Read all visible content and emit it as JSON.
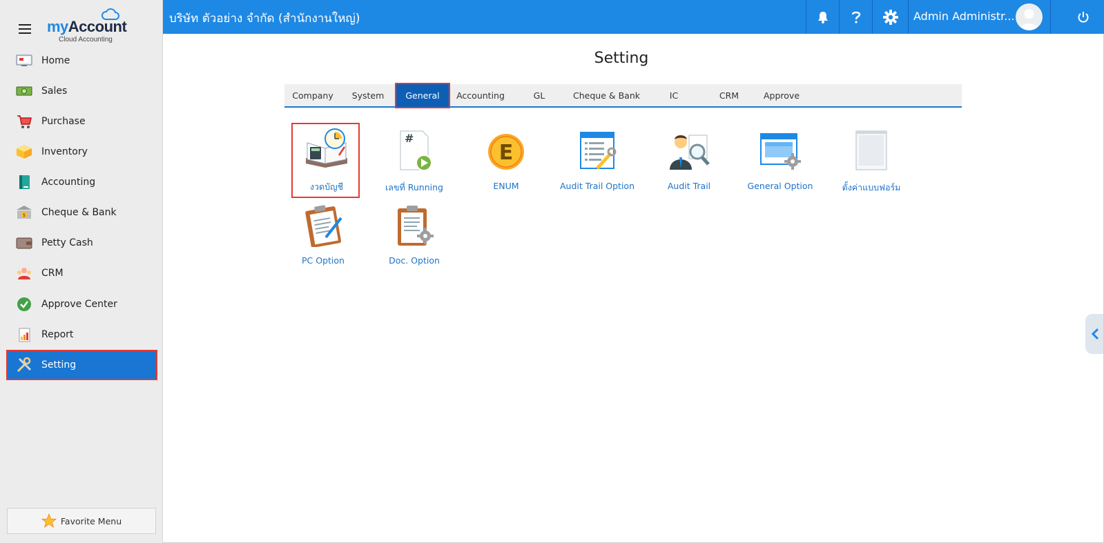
{
  "app": {
    "logo_name_prefix": "my",
    "logo_name_suffix": "Account",
    "logo_subtitle": "Cloud Accounting"
  },
  "header": {
    "company": "บริษัท ตัวอย่าง จำกัด (สำนักงานใหญ่)",
    "user": "Admin Administr...",
    "icons": [
      "bell-icon",
      "help-icon",
      "gear-icon",
      "power-icon"
    ],
    "color": "#1e88e5"
  },
  "sidebar": {
    "items": [
      {
        "label": "Home",
        "icon": "home-icon"
      },
      {
        "label": "Sales",
        "icon": "sales-icon"
      },
      {
        "label": "Purchase",
        "icon": "cart-icon"
      },
      {
        "label": "Inventory",
        "icon": "box-icon"
      },
      {
        "label": "Accounting",
        "icon": "ledger-icon"
      },
      {
        "label": "Cheque & Bank",
        "icon": "bank-icon"
      },
      {
        "label": "Petty Cash",
        "icon": "wallet-icon"
      },
      {
        "label": "CRM",
        "icon": "people-icon"
      },
      {
        "label": "Approve Center",
        "icon": "check-icon"
      },
      {
        "label": "Report",
        "icon": "report-icon"
      },
      {
        "label": "Setting",
        "icon": "tools-icon",
        "active": true
      }
    ],
    "favorite_label": "Favorite Menu",
    "active_color": "#1976d2"
  },
  "main": {
    "title": "Setting",
    "tabs": [
      {
        "label": "Company"
      },
      {
        "label": "System"
      },
      {
        "label": "General",
        "active": true
      },
      {
        "label": "Accounting"
      },
      {
        "label": "GL"
      },
      {
        "label": "Cheque & Bank"
      },
      {
        "label": "IC"
      },
      {
        "label": "CRM"
      },
      {
        "label": "Approve"
      }
    ],
    "tiles": [
      {
        "label": "งวดบัญชี",
        "icon": "accounting-period-icon",
        "selected": true
      },
      {
        "label": "เลขที่ Running",
        "icon": "running-number-icon"
      },
      {
        "label": "ENUM",
        "icon": "enum-icon"
      },
      {
        "label": "Audit Trail Option",
        "icon": "audit-trail-option-icon"
      },
      {
        "label": "Audit Trail",
        "icon": "audit-trail-icon"
      },
      {
        "label": "General Option",
        "icon": "general-option-icon"
      },
      {
        "label": "ตั้งค่าแบบฟอร์ม",
        "icon": "form-setting-icon"
      },
      {
        "label": "PC Option",
        "icon": "pc-option-icon"
      },
      {
        "label": "Doc. Option",
        "icon": "doc-option-icon"
      }
    ],
    "link_color": "#1e73c8",
    "highlight_color": "#e53935"
  }
}
